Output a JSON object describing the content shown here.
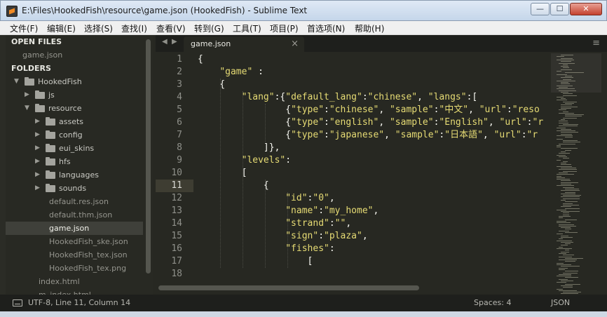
{
  "window": {
    "title": "E:\\Files\\HookedFish\\resource\\game.json (HookedFish) - Sublime Text",
    "minimize": "—",
    "maximize": "☐",
    "close": "✕"
  },
  "menu": [
    "文件(F)",
    "编辑(E)",
    "选择(S)",
    "查找(I)",
    "查看(V)",
    "转到(G)",
    "工具(T)",
    "项目(P)",
    "首选项(N)",
    "帮助(H)"
  ],
  "sidebar": {
    "open_files_header": "OPEN FILES",
    "open_files": [
      "game.json"
    ],
    "folders_header": "FOLDERS",
    "tree": [
      {
        "label": "HookedFish",
        "type": "folder",
        "depth": 0,
        "open": true
      },
      {
        "label": "js",
        "type": "folder",
        "depth": 1,
        "open": false
      },
      {
        "label": "resource",
        "type": "folder",
        "depth": 1,
        "open": true
      },
      {
        "label": "assets",
        "type": "folder",
        "depth": 2,
        "open": false
      },
      {
        "label": "config",
        "type": "folder",
        "depth": 2,
        "open": false
      },
      {
        "label": "eui_skins",
        "type": "folder",
        "depth": 2,
        "open": false
      },
      {
        "label": "hfs",
        "type": "folder",
        "depth": 2,
        "open": false
      },
      {
        "label": "languages",
        "type": "folder",
        "depth": 2,
        "open": false
      },
      {
        "label": "sounds",
        "type": "folder",
        "depth": 2,
        "open": false
      },
      {
        "label": "default.res.json",
        "type": "file",
        "depth": 2
      },
      {
        "label": "default.thm.json",
        "type": "file",
        "depth": 2
      },
      {
        "label": "game.json",
        "type": "file",
        "depth": 2,
        "selected": true
      },
      {
        "label": "HookedFish_ske.json",
        "type": "file",
        "depth": 2
      },
      {
        "label": "HookedFish_tex.json",
        "type": "file",
        "depth": 2
      },
      {
        "label": "HookedFish_tex.png",
        "type": "file",
        "depth": 2
      },
      {
        "label": "index.html",
        "type": "file",
        "depth": 1
      },
      {
        "label": "m_index.html",
        "type": "file",
        "depth": 1
      }
    ]
  },
  "tabs": {
    "active": "game.json",
    "close_glyph": "×",
    "prev_glyph": "◀",
    "next_glyph": "▶",
    "menu_glyph": "≡"
  },
  "editor": {
    "current_line": 11,
    "line_numbers": [
      "1",
      "2",
      "3",
      "4",
      "5",
      "6",
      "7",
      "8",
      "9",
      "10",
      "11",
      "12",
      "13",
      "14",
      "15",
      "16",
      "17",
      "18"
    ],
    "lines": [
      [
        {
          "t": "p",
          "v": "{"
        }
      ],
      [
        {
          "t": "p",
          "v": "    "
        },
        {
          "t": "s",
          "v": "\"game\""
        },
        {
          "t": "p",
          "v": " :"
        }
      ],
      [
        {
          "t": "p",
          "v": "    {"
        }
      ],
      [
        {
          "t": "p",
          "v": "        "
        },
        {
          "t": "s",
          "v": "\"lang\""
        },
        {
          "t": "p",
          "v": ":{"
        },
        {
          "t": "s",
          "v": "\"default_lang\""
        },
        {
          "t": "p",
          "v": ":"
        },
        {
          "t": "s",
          "v": "\"chinese\""
        },
        {
          "t": "p",
          "v": ", "
        },
        {
          "t": "s",
          "v": "\"langs\""
        },
        {
          "t": "p",
          "v": ":["
        }
      ],
      [
        {
          "t": "p",
          "v": "                {"
        },
        {
          "t": "s",
          "v": "\"type\""
        },
        {
          "t": "p",
          "v": ":"
        },
        {
          "t": "s",
          "v": "\"chinese\""
        },
        {
          "t": "p",
          "v": ", "
        },
        {
          "t": "s",
          "v": "\"sample\""
        },
        {
          "t": "p",
          "v": ":"
        },
        {
          "t": "s",
          "v": "\"中文\""
        },
        {
          "t": "p",
          "v": ", "
        },
        {
          "t": "s",
          "v": "\"url\""
        },
        {
          "t": "p",
          "v": ":"
        },
        {
          "t": "s",
          "v": "\"reso"
        }
      ],
      [
        {
          "t": "p",
          "v": "                {"
        },
        {
          "t": "s",
          "v": "\"type\""
        },
        {
          "t": "p",
          "v": ":"
        },
        {
          "t": "s",
          "v": "\"english\""
        },
        {
          "t": "p",
          "v": ", "
        },
        {
          "t": "s",
          "v": "\"sample\""
        },
        {
          "t": "p",
          "v": ":"
        },
        {
          "t": "s",
          "v": "\"English\""
        },
        {
          "t": "p",
          "v": ", "
        },
        {
          "t": "s",
          "v": "\"url\""
        },
        {
          "t": "p",
          "v": ":"
        },
        {
          "t": "s",
          "v": "\"r"
        }
      ],
      [
        {
          "t": "p",
          "v": "                {"
        },
        {
          "t": "s",
          "v": "\"type\""
        },
        {
          "t": "p",
          "v": ":"
        },
        {
          "t": "s",
          "v": "\"japanese\""
        },
        {
          "t": "p",
          "v": ", "
        },
        {
          "t": "s",
          "v": "\"sample\""
        },
        {
          "t": "p",
          "v": ":"
        },
        {
          "t": "s",
          "v": "\"日本語\""
        },
        {
          "t": "p",
          "v": ", "
        },
        {
          "t": "s",
          "v": "\"url\""
        },
        {
          "t": "p",
          "v": ":"
        },
        {
          "t": "s",
          "v": "\"r"
        }
      ],
      [
        {
          "t": "p",
          "v": "            ]},"
        }
      ],
      [
        {
          "t": "p",
          "v": "        "
        },
        {
          "t": "s",
          "v": "\"levels\""
        },
        {
          "t": "p",
          "v": ":"
        }
      ],
      [
        {
          "t": "p",
          "v": "        ["
        }
      ],
      [
        {
          "t": "p",
          "v": "            {"
        }
      ],
      [
        {
          "t": "p",
          "v": "                "
        },
        {
          "t": "s",
          "v": "\"id\""
        },
        {
          "t": "p",
          "v": ":"
        },
        {
          "t": "s",
          "v": "\"0\""
        },
        {
          "t": "p",
          "v": ","
        }
      ],
      [
        {
          "t": "p",
          "v": "                "
        },
        {
          "t": "s",
          "v": "\"name\""
        },
        {
          "t": "p",
          "v": ":"
        },
        {
          "t": "s",
          "v": "\"my_home\""
        },
        {
          "t": "p",
          "v": ","
        }
      ],
      [
        {
          "t": "p",
          "v": "                "
        },
        {
          "t": "s",
          "v": "\"strand\""
        },
        {
          "t": "p",
          "v": ":"
        },
        {
          "t": "s",
          "v": "\"\""
        },
        {
          "t": "p",
          "v": ","
        }
      ],
      [
        {
          "t": "p",
          "v": "                "
        },
        {
          "t": "s",
          "v": "\"sign\""
        },
        {
          "t": "p",
          "v": ":"
        },
        {
          "t": "s",
          "v": "\"plaza\""
        },
        {
          "t": "p",
          "v": ","
        }
      ],
      [
        {
          "t": "p",
          "v": "                "
        },
        {
          "t": "s",
          "v": "\"fishes\""
        },
        {
          "t": "p",
          "v": ":"
        }
      ],
      [
        {
          "t": "p",
          "v": "                    ["
        }
      ],
      [
        {
          "t": "p",
          "v": ""
        }
      ]
    ]
  },
  "status": {
    "position": "UTF-8, Line 11, Column 14",
    "indentation": "Spaces: 4",
    "syntax": "JSON"
  },
  "colors": {
    "background": "#272822",
    "string": "#e6db74",
    "text": "#f8f8f2",
    "line_number": "#8f908a"
  }
}
